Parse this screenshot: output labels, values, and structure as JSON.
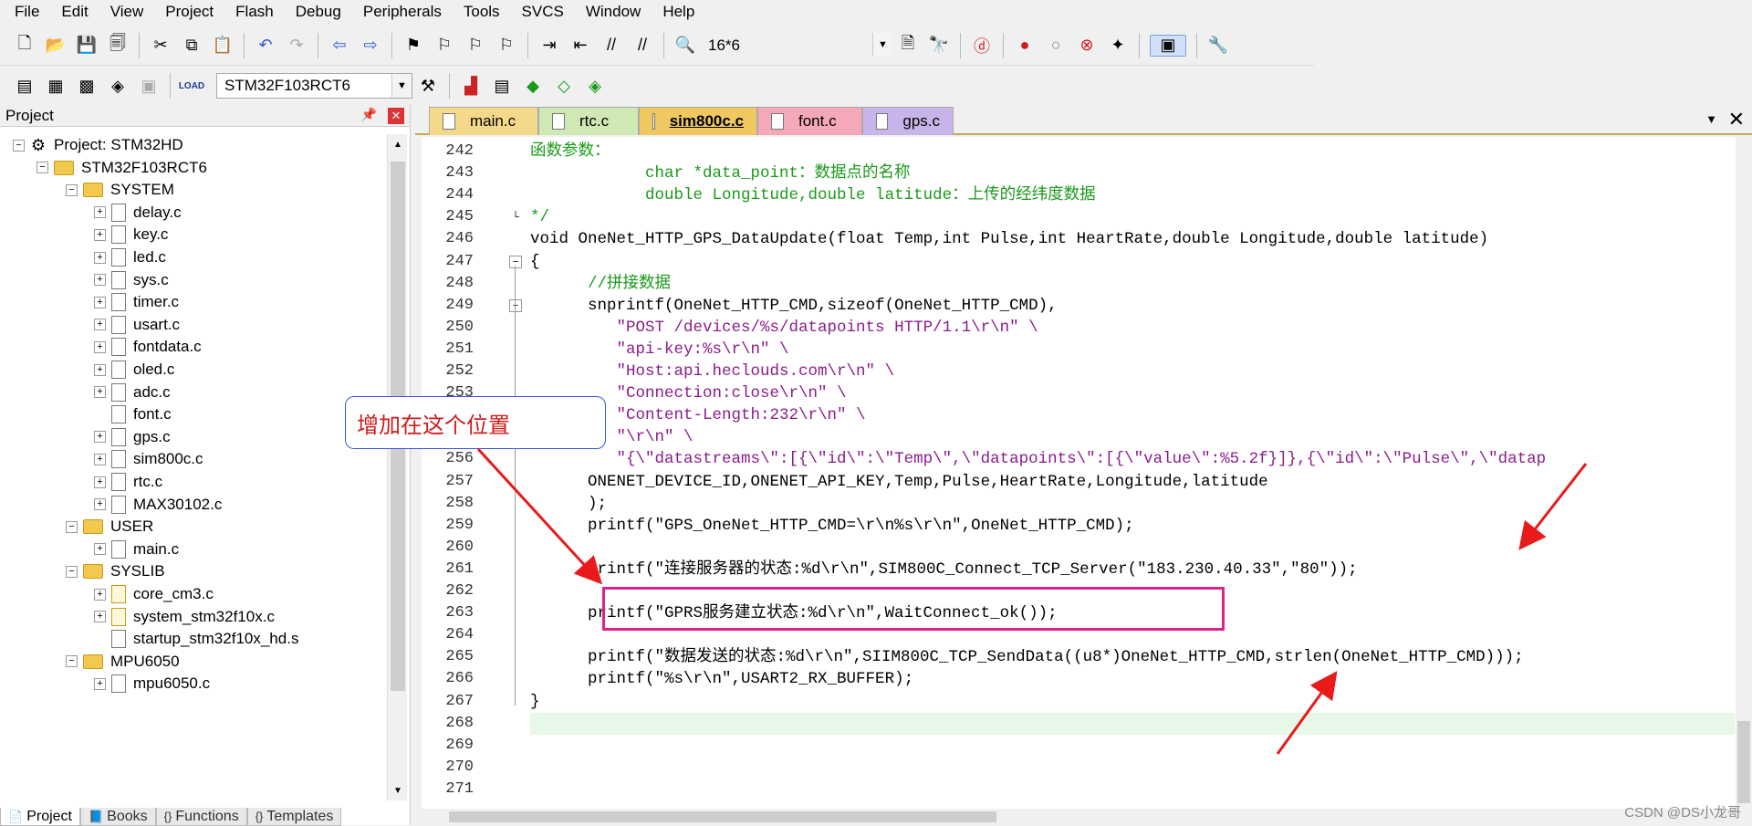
{
  "menu": [
    "File",
    "Edit",
    "View",
    "Project",
    "Flash",
    "Debug",
    "Peripherals",
    "Tools",
    "SVCS",
    "Window",
    "Help"
  ],
  "toolbar": {
    "find_value": "16*6",
    "target_value": "STM32F103RCT6",
    "icons": [
      "new-file-icon",
      "open-icon",
      "save-icon",
      "save-all-icon",
      "cut-icon",
      "copy-icon",
      "paste-icon",
      "undo-icon",
      "redo-icon",
      "nav-back-icon",
      "nav-forward-icon",
      "bookmark-icon",
      "prev-bookmark-icon",
      "next-bookmark-icon",
      "clear-bookmarks-icon",
      "indent-icon",
      "unindent-icon",
      "comment-icon",
      "uncomment-icon",
      "find-in-files-icon",
      "find-icon",
      "incremental-find-icon",
      "debug-icon",
      "breakpoint-icon",
      "disable-breakpoint-icon",
      "kill-breakpoints-icon",
      "config-icon",
      "window-icon",
      "tools-icon"
    ]
  },
  "project": {
    "title": "Project",
    "root": "Project: STM32HD",
    "target": "STM32F103RCT6",
    "groups": [
      {
        "name": "SYSTEM",
        "files": [
          "delay.c",
          "key.c",
          "led.c",
          "sys.c",
          "timer.c",
          "usart.c",
          "fontdata.c",
          "oled.c",
          "adc.c",
          "font.c",
          "gps.c",
          "sim800c.c",
          "rtc.c",
          "MAX30102.c"
        ]
      },
      {
        "name": "USER",
        "files": [
          "main.c"
        ]
      },
      {
        "name": "SYSLIB",
        "files": [
          "core_cm3.c",
          "system_stm32f10x.c",
          "startup_stm32f10x_hd.s"
        ]
      },
      {
        "name": "MPU6050",
        "files": [
          "mpu6050.c"
        ]
      }
    ],
    "bottom_tabs": [
      "Project",
      "Books",
      "Functions",
      "Templates"
    ]
  },
  "editor": {
    "tabs": [
      {
        "label": "main.c",
        "color": "#f5d98a"
      },
      {
        "label": "rtc.c",
        "color": "#cfe8b4"
      },
      {
        "label": "sim800c.c",
        "color": "#f0c860",
        "active": true
      },
      {
        "label": "font.c",
        "color": "#f5a8b8"
      },
      {
        "label": "gps.c",
        "color": "#c8b4e8"
      }
    ],
    "lines": [
      {
        "n": "242",
        "text": "函数参数：",
        "cls": "gr"
      },
      {
        "n": "243",
        "text": "            char *data_point：数据点的名称",
        "cls": "gr"
      },
      {
        "n": "244",
        "text": "            double Longitude,double latitude：上传的经纬度数据",
        "cls": "gr"
      },
      {
        "n": "245",
        "text": "*/",
        "cls": "gr"
      },
      {
        "n": "246",
        "text": "void OneNet_HTTP_GPS_DataUpdate(float Temp,int Pulse,int HeartRate,double Longitude,double latitude)",
        "cls": "in"
      },
      {
        "n": "247",
        "text": "{",
        "cls": "in"
      },
      {
        "n": "248",
        "text": "      //拼接数据",
        "cls": "gr"
      },
      {
        "n": "249",
        "text": "      snprintf(OneNet_HTTP_CMD,sizeof(OneNet_HTTP_CMD),",
        "cls": "in"
      },
      {
        "n": "250",
        "text": "         \"POST /devices/%s/datapoints HTTP/1.1\\r\\n\" \\",
        "cls": "pu"
      },
      {
        "n": "251",
        "text": "         \"api-key:%s\\r\\n\" \\",
        "cls": "pu"
      },
      {
        "n": "252",
        "text": "         \"Host:api.heclouds.com\\r\\n\" \\",
        "cls": "pu"
      },
      {
        "n": "253",
        "text": "         \"Connection:close\\r\\n\" \\",
        "cls": "pu"
      },
      {
        "n": "254",
        "text": "         \"Content-Length:232\\r\\n\" \\",
        "cls": "pu"
      },
      {
        "n": "255",
        "text": "         \"\\r\\n\" \\",
        "cls": "pu"
      },
      {
        "n": "256",
        "text": "         \"{\\\"datastreams\\\":[{\\\"id\\\":\\\"Temp\\\",\\\"datapoints\\\":[{\\\"value\\\":%5.2f}]},{\\\"id\\\":\\\"Pulse\\\",\\\"datap",
        "cls": "pu"
      },
      {
        "n": "257",
        "text": "      ONENET_DEVICE_ID,ONENET_API_KEY,Temp,Pulse,HeartRate,Longitude,latitude",
        "cls": "in"
      },
      {
        "n": "258",
        "text": "      );",
        "cls": "in"
      },
      {
        "n": "259",
        "text": "      printf(\"GPS_OneNet_HTTP_CMD=\\r\\n%s\\r\\n\",OneNet_HTTP_CMD);",
        "cls": "in"
      },
      {
        "n": "260",
        "text": "",
        "cls": "in"
      },
      {
        "n": "261",
        "text": "      printf(\"连接服务器的状态:%d\\r\\n\",SIM800C_Connect_TCP_Server(\"183.230.40.33\",\"80\"));",
        "cls": "in"
      },
      {
        "n": "262",
        "text": "",
        "cls": "in"
      },
      {
        "n": "263",
        "text": "      printf(\"GPRS服务建立状态:%d\\r\\n\",WaitConnect_ok());",
        "cls": "in"
      },
      {
        "n": "264",
        "text": "",
        "cls": "in"
      },
      {
        "n": "265",
        "text": "      printf(\"数据发送的状态:%d\\r\\n\",SIIM800C_TCP_SendData((u8*)OneNet_HTTP_CMD,strlen(OneNet_HTTP_CMD)));",
        "cls": "in"
      },
      {
        "n": "266",
        "text": "      printf(\"%s\\r\\n\",USART2_RX_BUFFER);",
        "cls": "in"
      },
      {
        "n": "267",
        "text": "}",
        "cls": "in"
      },
      {
        "n": "268",
        "text": "",
        "cls": "hl"
      },
      {
        "n": "269",
        "text": "",
        "cls": "in"
      },
      {
        "n": "270",
        "text": "",
        "cls": "in"
      },
      {
        "n": "271",
        "text": "",
        "cls": "in"
      }
    ]
  },
  "annotation": {
    "callout": "增加在这个位置",
    "accent": "#e0218a",
    "arrow_color": "#e81a1a"
  },
  "watermark": "CSDN @DS小龙哥"
}
